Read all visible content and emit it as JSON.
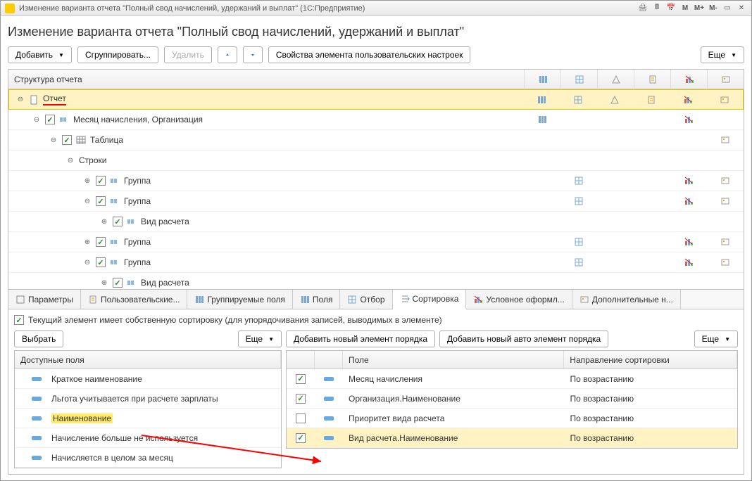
{
  "window": {
    "title": "Изменение варианта отчета \"Полный свод начислений, удержаний и выплат\"  (1С:Предприятие)",
    "sys": {
      "m": "M",
      "mplus": "M+",
      "mminus": "M-"
    }
  },
  "header": {
    "title": "Изменение варианта отчета \"Полный свод начислений, удержаний и выплат\""
  },
  "toolbar": {
    "add": "Добавить",
    "group": "Сгруппировать...",
    "delete": "Удалить",
    "props": "Свойства элемента пользовательских настроек",
    "more": "Еще"
  },
  "tree": {
    "header": "Структура отчета",
    "rows": [
      {
        "indent": 0,
        "expand": true,
        "doc": true,
        "label": "Отчет",
        "selected": true,
        "icons": [
          1,
          2,
          3,
          4,
          5,
          6
        ]
      },
      {
        "indent": 1,
        "expand": true,
        "chk": true,
        "mini": true,
        "label": "Месяц начисления, Организация",
        "icons": [
          1,
          0,
          0,
          0,
          5,
          0
        ]
      },
      {
        "indent": 2,
        "expand": true,
        "chk": true,
        "table": true,
        "label": "Таблица",
        "icons": [
          0,
          0,
          0,
          0,
          0,
          6
        ]
      },
      {
        "indent": 3,
        "expand": true,
        "label": "Строки",
        "icons": []
      },
      {
        "indent": 4,
        "expand": false,
        "chk": true,
        "mini": true,
        "label": "Группа",
        "icons": [
          0,
          2,
          0,
          0,
          5,
          6
        ]
      },
      {
        "indent": 4,
        "expand": true,
        "chk": true,
        "mini": true,
        "label": "Группа",
        "icons": [
          0,
          2,
          0,
          0,
          5,
          6
        ]
      },
      {
        "indent": 5,
        "expand": false,
        "chk": true,
        "mini": true,
        "label": "Вид расчета",
        "icons": []
      },
      {
        "indent": 4,
        "expand": false,
        "chk": true,
        "mini": true,
        "label": "Группа",
        "icons": [
          0,
          2,
          0,
          0,
          5,
          6
        ]
      },
      {
        "indent": 4,
        "expand": true,
        "chk": true,
        "mini": true,
        "label": "Группа",
        "icons": [
          0,
          2,
          0,
          0,
          5,
          6
        ]
      },
      {
        "indent": 5,
        "expand": false,
        "chk": true,
        "mini": true,
        "label": "Вид расчета",
        "icons": []
      }
    ]
  },
  "tabs": {
    "items": [
      "Параметры",
      "Пользовательские...",
      "Группируемые поля",
      "Поля",
      "Отбор",
      "Сортировка",
      "Условное оформл...",
      "Дополнительные н..."
    ],
    "active": 5
  },
  "bottom": {
    "ownSort": "Текущий элемент имеет собственную сортировку (для  упорядочивания записей, выводимых в элементе)",
    "select": "Выбрать",
    "more": "Еще",
    "addOrder": "Добавить новый элемент порядка",
    "addAutoOrder": "Добавить новый авто элемент порядка",
    "leftHeader": "Доступные поля",
    "rightHeaders": {
      "field": "Поле",
      "dir": "Направление сортировки"
    },
    "availFields": [
      "Краткое наименование",
      "Льгота учитывается при расчете зарплаты",
      "Наименование",
      "Начисление больше не используется",
      "Начисляется в целом за месяц"
    ],
    "highlightIndex": 2,
    "sortRows": [
      {
        "chk": true,
        "field": "Месяц начисления",
        "dir": "По возрастанию"
      },
      {
        "chk": true,
        "field": "Организация.Наименование",
        "dir": "По возрастанию"
      },
      {
        "chk": false,
        "field": "Приоритет вида расчета",
        "dir": "По возрастанию"
      },
      {
        "chk": true,
        "field": "Вид расчета.Наименование",
        "dir": "По возрастанию",
        "highlight": true
      }
    ]
  }
}
